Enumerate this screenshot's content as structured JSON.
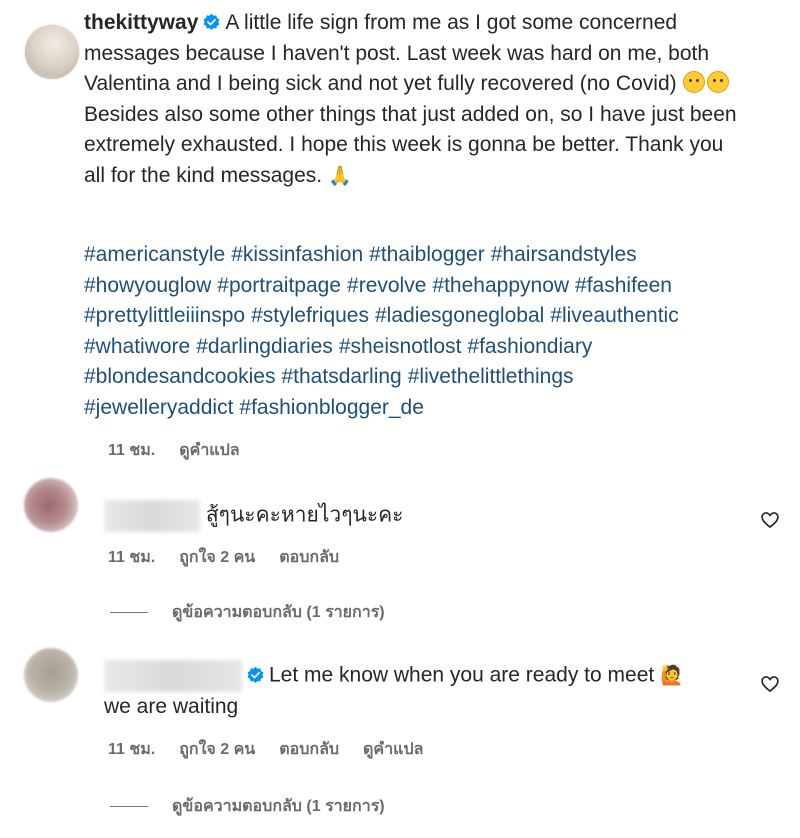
{
  "post": {
    "username": "thekittyway",
    "caption_parts": [
      "A little life sign from me as I got some concerned messages because I haven't post. Last week was hard on me, both Valentina and I being sick and not yet fully recovered (no Covid)",
      "Besides also some other things that just added on, so I have just been extremely exhausted. I hope this week is gonna be better. Thank you all for the kind messages."
    ],
    "hashtags": [
      "#americanstyle",
      "#kissinfashion",
      "#thaiblogger",
      "#hairsandstyles",
      "#howyouglow",
      "#portraitpage",
      "#revolve",
      "#thehappynow",
      "#fashifeen",
      "#prettylittleiiinspo",
      "#stylefriques",
      "#ladiesgoneglobal",
      "#liveauthentic",
      "#whatiwore",
      "#darlingdiaries",
      "#sheisnotlost",
      "#fashiondiary",
      "#blondesandcookies",
      "#thatsdarling",
      "#livethelittlethings",
      "#jewelleryaddict",
      "#fashionblogger_de"
    ],
    "time": "11 ชม.",
    "translate": "ดูคำแปล"
  },
  "comments": [
    {
      "text": "สู้ๆนะคะหายไวๆนะคะ",
      "time": "11 ชม.",
      "likes": "ถูกใจ 2 คน",
      "reply": "ตอบกลับ",
      "view_replies": "ดูข้อความตอบกลับ (1 รายการ)"
    },
    {
      "text_line1": "Let me know when you are ready to meet",
      "text_line2": "we are waiting",
      "time": "11 ชม.",
      "likes": "ถูกใจ 2 คน",
      "reply": "ตอบกลับ",
      "translate": "ดูคำแปล",
      "view_replies": "ดูข้อความตอบกลับ (1 รายการ)"
    }
  ],
  "colors": {
    "hashtag": "#1e4f7a",
    "verified": "#0095f6",
    "meta": "#6b6b6b"
  }
}
